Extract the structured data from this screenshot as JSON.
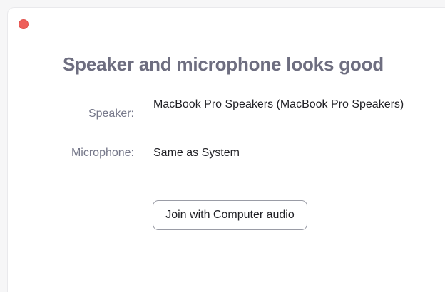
{
  "window": {
    "title": "Speaker and microphone looks good",
    "close_color": "#ee5f5a"
  },
  "speaker": {
    "label": "Speaker:",
    "value": "MacBook Pro Speakers (MacBook Pro Speakers)"
  },
  "microphone": {
    "label": "Microphone:",
    "value": "Same as System"
  },
  "actions": {
    "join_label": "Join with Computer audio"
  }
}
